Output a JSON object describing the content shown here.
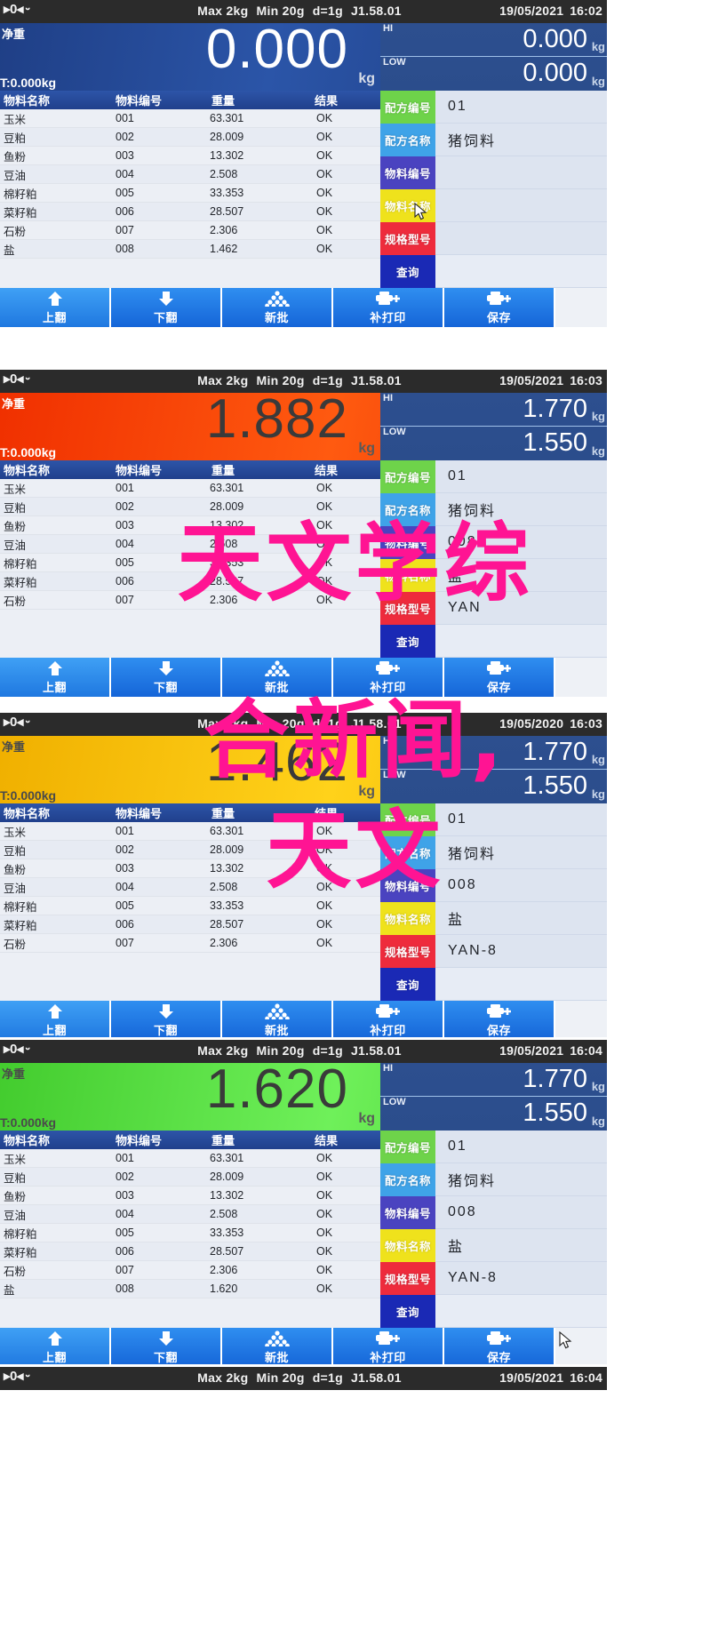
{
  "device": {
    "status_bar": {
      "zero_icon": "zero-arrow-icon",
      "stable_icon": "stability-icon",
      "specs": [
        "Max 2kg",
        "Min 20g",
        "d=1g",
        "J1.58.01"
      ]
    },
    "labels": {
      "net": "净重",
      "tare_prefix": "T:",
      "unit": "kg",
      "hi": "HI",
      "low": "LOW"
    },
    "table_headers": [
      "物料名称",
      "物料编号",
      "重量",
      "结果"
    ],
    "form_keys": {
      "formula_no": "配方编号",
      "formula_name": "配方名称",
      "material_no": "物料编号",
      "material_name": "物料名称",
      "spec_model": "规格型号",
      "query": "查询"
    },
    "toolbar": [
      {
        "label": "上翻",
        "icon": "arrow-up-icon"
      },
      {
        "label": "下翻",
        "icon": "arrow-down-icon"
      },
      {
        "label": "新批",
        "icon": "stack-batch-icon"
      },
      {
        "label": "补打印",
        "icon": "printer-plus-icon"
      },
      {
        "label": "保存",
        "icon": "printer-save-icon"
      }
    ],
    "colors": {
      "key_green": "#6ed34a",
      "key_blue": "#3fa3e8",
      "key_purple": "#4a43c0",
      "key_yellow": "#efe21c",
      "key_red": "#ee2b3c",
      "key_navy": "#1a29b5",
      "toolbar_blue": "#1565d8",
      "display_blue": "#22449a",
      "display_red": "#f03000",
      "display_yellow": "#ffc400",
      "display_green": "#52dd36",
      "overlay_pink": "#ff1493"
    }
  },
  "panels": [
    {
      "datetime": {
        "date": "19/05/2021",
        "time": "16:02"
      },
      "display_theme": "blue",
      "weight": "0.000",
      "tare": "0.000kg",
      "hi": "0.000",
      "low": "0.000",
      "rows": [
        {
          "name": "玉米",
          "code": "001",
          "weight": "63.301",
          "result": "OK"
        },
        {
          "name": "豆粕",
          "code": "002",
          "weight": "28.009",
          "result": "OK"
        },
        {
          "name": "鱼粉",
          "code": "003",
          "weight": "13.302",
          "result": "OK"
        },
        {
          "name": "豆油",
          "code": "004",
          "weight": "2.508",
          "result": "OK"
        },
        {
          "name": "棉籽粕",
          "code": "005",
          "weight": "33.353",
          "result": "OK"
        },
        {
          "name": "菜籽粕",
          "code": "006",
          "weight": "28.507",
          "result": "OK"
        },
        {
          "name": "石粉",
          "code": "007",
          "weight": "2.306",
          "result": "OK"
        },
        {
          "name": "盐",
          "code": "008",
          "weight": "1.462",
          "result": "OK"
        }
      ],
      "form_values": {
        "formula_no": "01",
        "formula_name": "猪饲料",
        "material_no": "",
        "material_name": "",
        "spec_model": ""
      }
    },
    {
      "datetime": {
        "date": "19/05/2021",
        "time": "16:03"
      },
      "display_theme": "red",
      "weight": "1.882",
      "tare": "0.000kg",
      "hi": "1.770",
      "low": "1.550",
      "rows": [
        {
          "name": "玉米",
          "code": "001",
          "weight": "63.301",
          "result": "OK"
        },
        {
          "name": "豆粕",
          "code": "002",
          "weight": "28.009",
          "result": "OK"
        },
        {
          "name": "鱼粉",
          "code": "003",
          "weight": "13.302",
          "result": "OK"
        },
        {
          "name": "豆油",
          "code": "004",
          "weight": "2.508",
          "result": "OK"
        },
        {
          "name": "棉籽粕",
          "code": "005",
          "weight": "33.353",
          "result": "OK"
        },
        {
          "name": "菜籽粕",
          "code": "006",
          "weight": "28.507",
          "result": "OK"
        },
        {
          "name": "石粉",
          "code": "007",
          "weight": "2.306",
          "result": "OK"
        }
      ],
      "form_values": {
        "formula_no": "01",
        "formula_name": "猪饲料",
        "material_no": "008",
        "material_name": "盐",
        "spec_model": "YAN"
      }
    },
    {
      "datetime": {
        "date": "19/05/2020",
        "time": "16:03"
      },
      "display_theme": "yellow",
      "weight": "1.462",
      "tare": "0.000kg",
      "hi": "1.770",
      "low": "1.550",
      "rows": [
        {
          "name": "玉米",
          "code": "001",
          "weight": "63.301",
          "result": "OK"
        },
        {
          "name": "豆粕",
          "code": "002",
          "weight": "28.009",
          "result": "OK"
        },
        {
          "name": "鱼粉",
          "code": "003",
          "weight": "13.302",
          "result": "OK"
        },
        {
          "name": "豆油",
          "code": "004",
          "weight": "2.508",
          "result": "OK"
        },
        {
          "name": "棉籽粕",
          "code": "005",
          "weight": "33.353",
          "result": "OK"
        },
        {
          "name": "菜籽粕",
          "code": "006",
          "weight": "28.507",
          "result": "OK"
        },
        {
          "name": "石粉",
          "code": "007",
          "weight": "2.306",
          "result": "OK"
        }
      ],
      "form_values": {
        "formula_no": "01",
        "formula_name": "猪饲料",
        "material_no": "008",
        "material_name": "盐",
        "spec_model": "YAN-8"
      }
    },
    {
      "datetime": {
        "date": "19/05/2021",
        "time": "16:04"
      },
      "display_theme": "green",
      "weight": "1.620",
      "tare": "0.000kg",
      "hi": "1.770",
      "low": "1.550",
      "rows": [
        {
          "name": "玉米",
          "code": "001",
          "weight": "63.301",
          "result": "OK"
        },
        {
          "name": "豆粕",
          "code": "002",
          "weight": "28.009",
          "result": "OK"
        },
        {
          "name": "鱼粉",
          "code": "003",
          "weight": "13.302",
          "result": "OK"
        },
        {
          "name": "豆油",
          "code": "004",
          "weight": "2.508",
          "result": "OK"
        },
        {
          "name": "棉籽粕",
          "code": "005",
          "weight": "33.353",
          "result": "OK"
        },
        {
          "name": "菜籽粕",
          "code": "006",
          "weight": "28.507",
          "result": "OK"
        },
        {
          "name": "石粉",
          "code": "007",
          "weight": "2.306",
          "result": "OK"
        },
        {
          "name": "盐",
          "code": "008",
          "weight": "1.620",
          "result": "OK"
        }
      ],
      "form_values": {
        "formula_no": "01",
        "formula_name": "猪饲料",
        "material_no": "008",
        "material_name": "盐",
        "spec_model": "YAN-8"
      }
    },
    {
      "datetime": {
        "date": "19/05/2021",
        "time": "16:04"
      },
      "display_theme": "blue",
      "weight": "",
      "tare": "",
      "hi": "",
      "low": "",
      "rows": [],
      "form_values": {}
    }
  ],
  "overlay": {
    "line1": "天文学综",
    "line2": "合新闻,",
    "line3": "天文"
  }
}
